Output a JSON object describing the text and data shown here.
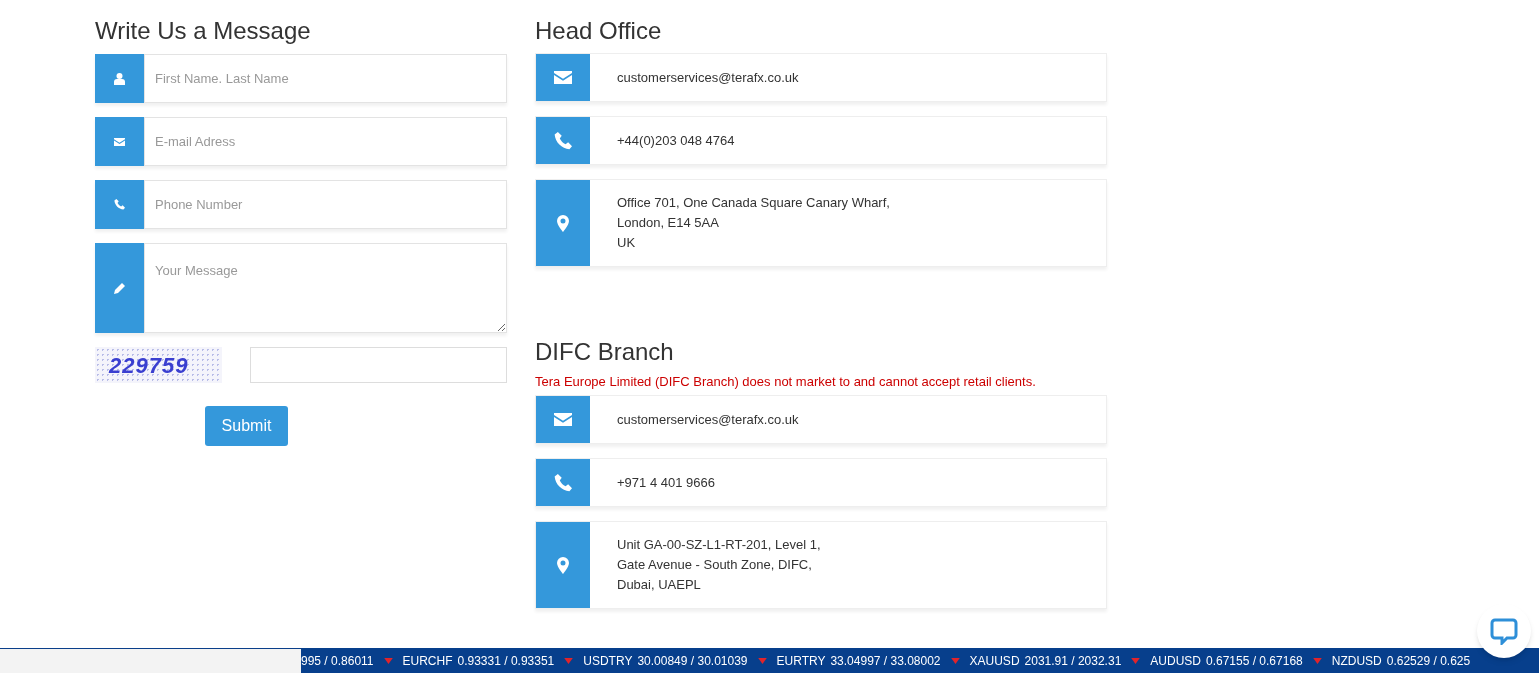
{
  "message_form": {
    "title": "Write Us a Message",
    "fields": [
      {
        "kind": "name",
        "placeholder": "First Name. Last Name"
      },
      {
        "kind": "email",
        "placeholder": "E-mail Adress"
      },
      {
        "kind": "phone",
        "placeholder": "Phone Number"
      },
      {
        "kind": "message",
        "placeholder": "Your Message"
      }
    ],
    "captcha": {
      "code": "229759"
    },
    "submit": "Submit"
  },
  "offices": [
    {
      "title": "Head Office",
      "items": [
        {
          "kind": "email",
          "lines": [
            "customerservices@terafx.co.uk"
          ]
        },
        {
          "kind": "phone",
          "lines": [
            "+44(0)203 048 4764"
          ]
        },
        {
          "kind": "address",
          "lines": [
            "Office 701, One Canada Square Canary Wharf,",
            "London, E14 5AA",
            "UK"
          ]
        }
      ]
    },
    {
      "title": "DIFC Branch",
      "note": "Tera Europe Limited (DIFC Branch) does not market to and cannot accept retail clients.",
      "items": [
        {
          "kind": "email",
          "lines": [
            "customerservices@terafx.co.uk"
          ]
        },
        {
          "kind": "phone",
          "lines": [
            "+971 4 401 9666"
          ]
        },
        {
          "kind": "address",
          "lines": [
            "Unit GA-00-SZ-L1-RT-201, Level 1,",
            "Gate Avenue - South Zone, DIFC,",
            "Dubai, UAEPL"
          ]
        }
      ]
    }
  ],
  "ticker": [
    {
      "price": "995 / 0.86011"
    },
    {
      "symbol": "EURCHF",
      "price": "0.93331 / 0.93351"
    },
    {
      "symbol": "USDTRY",
      "price": "30.00849 / 30.01039"
    },
    {
      "symbol": "EURTRY",
      "price": "33.04997 / 33.08002"
    },
    {
      "symbol": "XAUUSD",
      "price": "2031.91 / 2032.31"
    },
    {
      "symbol": "AUDUSD",
      "price": "0.67155 / 0.67168"
    },
    {
      "symbol": "NZDUSD",
      "price": "0.62529 / 0.625"
    }
  ]
}
